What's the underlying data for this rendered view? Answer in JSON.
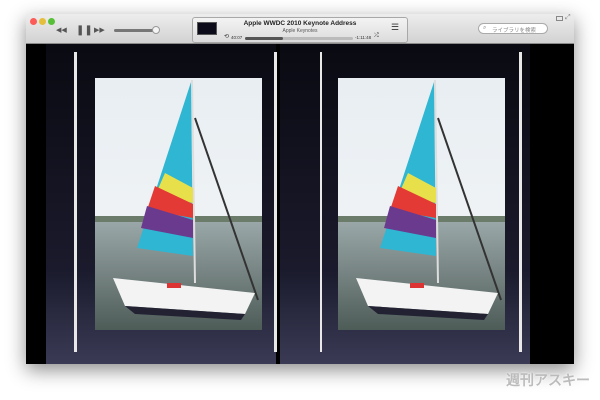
{
  "window": {
    "title": "Apple WWDC 2010 Keynote Address",
    "artist": "Apple Keynotes",
    "elapsed": "40:07",
    "remaining": "-1:11:48",
    "progress": 0.35,
    "volume": 1.0
  },
  "search": {
    "placeholder": "ライブラリを検索"
  },
  "controls": {
    "rewind": "◀◀",
    "pause": "❚❚",
    "forward": "▶▶",
    "repeat": "⟲",
    "shuffle": "⤮",
    "list": "☰"
  },
  "colors": {
    "close": "#fc5b57",
    "minimize": "#e5bf3c",
    "zoom": "#57c038"
  },
  "watermark": "週刊アスキー"
}
